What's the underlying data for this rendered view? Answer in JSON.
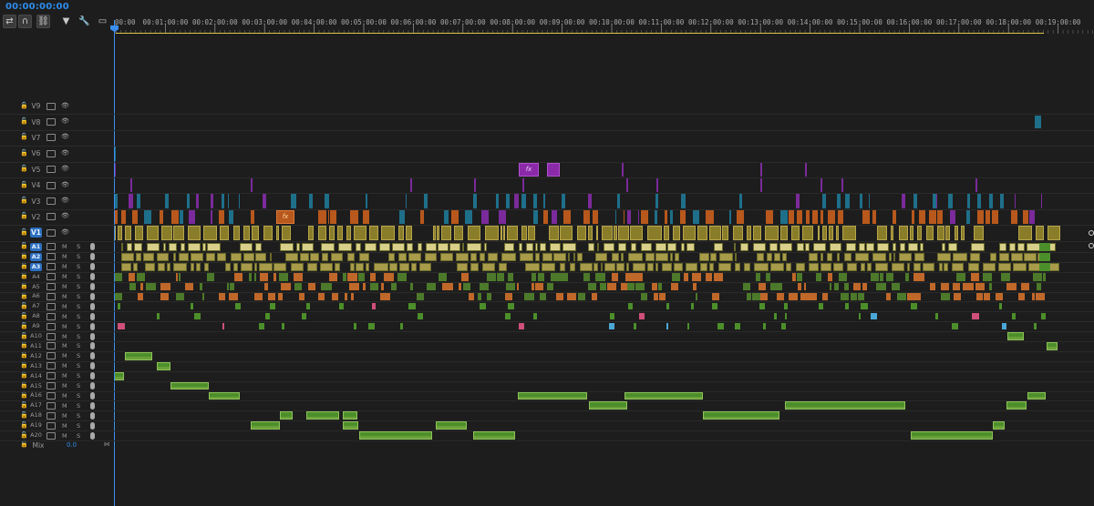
{
  "timecode": "00:00:00:00",
  "toolbar": [
    {
      "name": "insert-overwrite-tool",
      "icon": "nest-icon",
      "glyph": "⇄"
    },
    {
      "name": "snap-tool",
      "icon": "magnet-icon",
      "glyph": "∩"
    },
    {
      "name": "linked-selection-tool",
      "icon": "link-icon",
      "glyph": "⛓"
    },
    {
      "name": "add-marker-tool",
      "icon": "marker-icon",
      "glyph": "▼"
    },
    {
      "name": "settings-tool",
      "icon": "wrench-icon",
      "glyph": "🔧"
    },
    {
      "name": "captions-tool",
      "icon": "captions-icon",
      "glyph": "▭"
    }
  ],
  "ruler": {
    "labels": [
      ":00:00",
      "00:01:00:00",
      "00:02:00:00",
      "00:03:00:00",
      "00:04:00:00",
      "00:05:00:00",
      "00:06:00:00",
      "00:07:00:00",
      "00:08:00:00",
      "00:09:00:00",
      "00:10:00:00",
      "00:11:00:00",
      "00:12:00:00",
      "00:13:00:00",
      "00:14:00:00",
      "00:15:00:00",
      "00:16:00:00",
      "00:17:00:00",
      "00:18:00:00",
      "00:19:00:00"
    ]
  },
  "video_tracks": [
    "V9",
    "V8",
    "V7",
    "V6",
    "V5",
    "V4",
    "V3",
    "V2",
    "V1"
  ],
  "audio_tracks": [
    "A1",
    "A2",
    "A3",
    "A4",
    "A5",
    "A6",
    "A7",
    "A8",
    "A9",
    "A10",
    "A11",
    "A12",
    "A13",
    "A14",
    "A15",
    "A16",
    "A17",
    "A18",
    "A19",
    "A20"
  ],
  "active_tracks": [
    "V1",
    "A1",
    "A2",
    "A3"
  ],
  "audio_buttons": {
    "mute": "M",
    "solo": "S"
  },
  "mix": {
    "label": "Mix",
    "value": "0.0"
  },
  "clip_label": "fx",
  "colors": {
    "timecode": "#2d8ceb",
    "playhead": "#3b8ef0",
    "video_yellow": "#8a7d2a",
    "video_orange": "#b8581c",
    "video_teal": "#1e6f8a",
    "video_purple": "#7a2a9a",
    "audio_green": "#4c8f2a",
    "audio_light": "#d8d08a",
    "audio_pink": "#d0507a",
    "audio_cyan": "#4aa8d8"
  }
}
